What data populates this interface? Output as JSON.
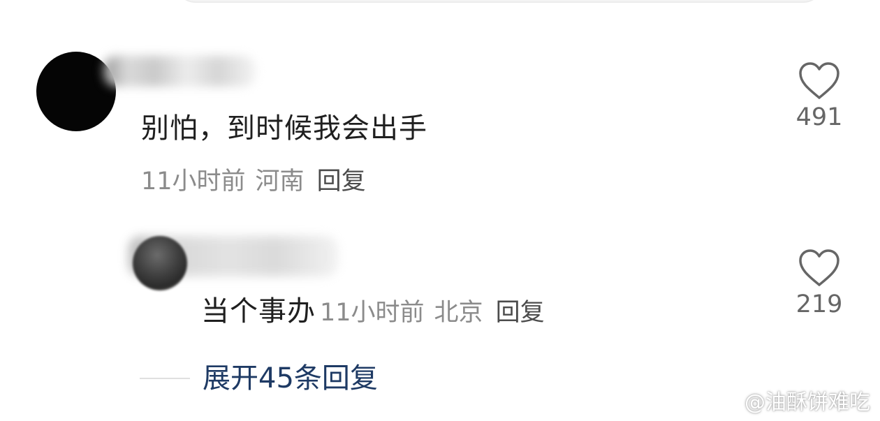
{
  "comment": {
    "text": "别怕，到时候我会出手",
    "time": "11小时前",
    "location": "河南",
    "reply_label": "回复",
    "like_count": "491"
  },
  "reply": {
    "text": "当个事办",
    "time": "11小时前",
    "location": "北京",
    "reply_label": "回复",
    "like_count": "219"
  },
  "expand": {
    "label": "展开45条回复"
  },
  "watermark": {
    "text": "@油酥饼难吃"
  },
  "colors": {
    "text_primary": "#1f1f1f",
    "text_meta": "#8b8b8b",
    "expand_link": "#1e3a64",
    "heart_stroke": "#666666"
  },
  "icons": {
    "like": "heart-outline-icon",
    "watermark": "weibo-logo-icon"
  }
}
